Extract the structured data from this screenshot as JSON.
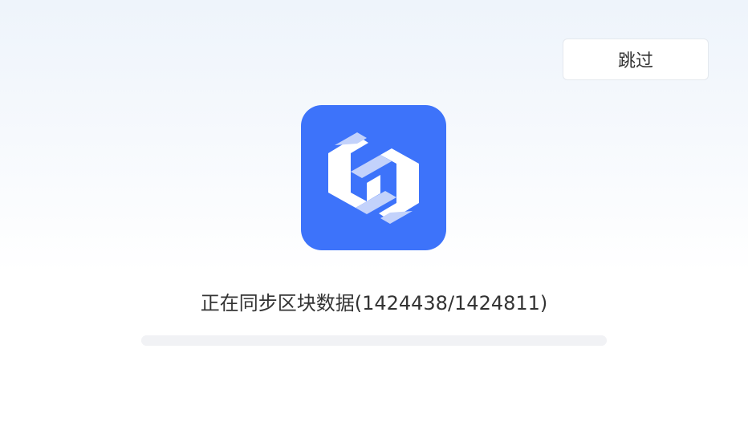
{
  "skip_button": {
    "label": "跳过"
  },
  "logo": {
    "icon": "sync-hexagon-logo-icon",
    "background_color": "#3d73fa",
    "mark_color": "#ffffff",
    "mark_shade_color": "#c3d2fb"
  },
  "sync_status": {
    "text": "正在同步区块数据(1424438/1424811)",
    "current_block": 1424438,
    "total_blocks": 1424811
  },
  "progress": {
    "track_color": "#f1f2f5"
  }
}
